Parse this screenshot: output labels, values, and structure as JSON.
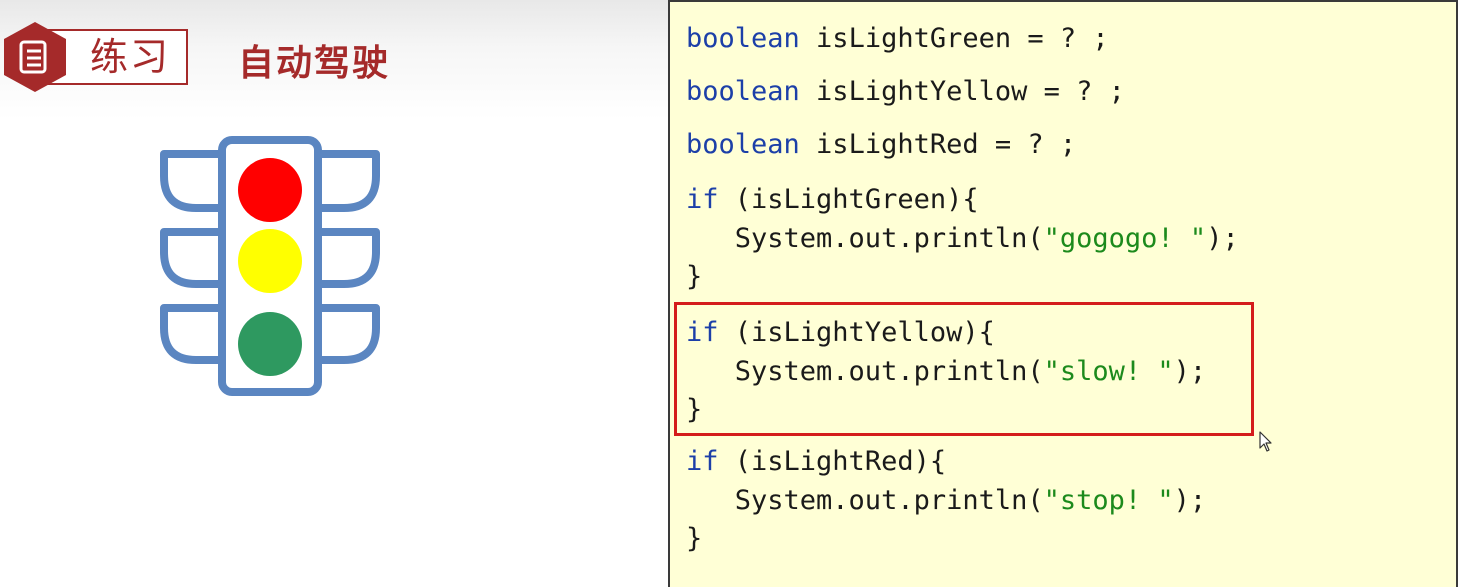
{
  "header": {
    "badge_label": "练习",
    "title": "自动驾驶"
  },
  "icons": {
    "badge": "document-icon",
    "illustration": "traffic-light-icon",
    "pointer": "mouse-cursor-icon"
  },
  "colors": {
    "accent": "#a52a2a",
    "light_red": "#ff0000",
    "light_yellow": "#ffff00",
    "light_green": "#2e9960",
    "frame": "#5b86c1",
    "keyword": "#1c3fa8",
    "string": "#1c8a1c",
    "highlight": "#d41c1c",
    "code_bg": "#ffffd6"
  },
  "code": {
    "decl_green": {
      "keyword": "boolean",
      "rest": " isLightGreen = ? ;"
    },
    "decl_yellow": {
      "keyword": "boolean",
      "rest": " isLightYellow = ? ;"
    },
    "decl_red": {
      "keyword": "boolean",
      "rest": " isLightRed = ? ;"
    },
    "if_green": {
      "keyword": "if",
      "rest": " (isLightGreen){",
      "print_pre": "   System.out.println(",
      "print_str": "\"gogogo! \"",
      "print_post": ");",
      "close": "}"
    },
    "if_yellow": {
      "keyword": "if",
      "rest": " (isLightYellow){",
      "print_pre": "   System.out.println(",
      "print_str": "\"slow! \"",
      "print_post": ");",
      "close": "}"
    },
    "if_red": {
      "keyword": "if",
      "rest": " (isLightRed){",
      "print_pre": "   System.out.println(",
      "print_str": "\"stop! \"",
      "print_post": ");",
      "close": "}"
    }
  }
}
